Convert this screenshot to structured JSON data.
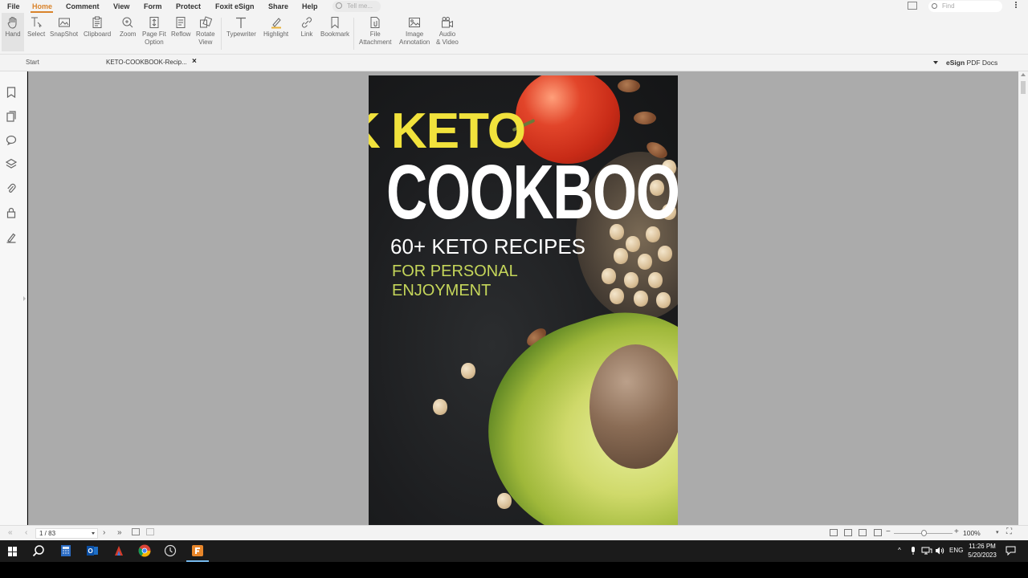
{
  "menu": {
    "items": [
      "File",
      "Home",
      "Comment",
      "View",
      "Form",
      "Protect",
      "Foxit eSign",
      "Share",
      "Help"
    ],
    "active": "Home",
    "tell_me_placeholder": "Tell me...",
    "find_placeholder": "Find"
  },
  "ribbon": {
    "tools": [
      {
        "label": "Hand",
        "icon": "hand-icon"
      },
      {
        "label": "Select",
        "icon": "select-icon"
      },
      {
        "label": "SnapShot",
        "icon": "snapshot-icon"
      },
      {
        "label": "Clipboard",
        "icon": "clipboard-icon"
      },
      {
        "label": "Zoom",
        "icon": "zoom-icon"
      },
      {
        "label": "Page Fit Option",
        "icon": "page-fit-icon"
      },
      {
        "label": "Reflow",
        "icon": "reflow-icon"
      },
      {
        "label": "Rotate View",
        "icon": "rotate-view-icon"
      },
      {
        "label": "Typewriter",
        "icon": "typewriter-icon"
      },
      {
        "label": "Highlight",
        "icon": "highlight-icon"
      },
      {
        "label": "Link",
        "icon": "link-icon"
      },
      {
        "label": "Bookmark",
        "icon": "bookmark-icon"
      },
      {
        "label": "File Attachment",
        "icon": "file-attachment-icon"
      },
      {
        "label": "Image Annotation",
        "icon": "image-annotation-icon"
      },
      {
        "label": "Audio & Video",
        "icon": "audio-video-icon"
      }
    ],
    "label_lines": {
      "page_fit_1": "Page Fit",
      "page_fit_2": "Option",
      "rotate_1": "Rotate",
      "rotate_2": "View",
      "file_att_1": "File",
      "file_att_2": "Attachment",
      "image_ann_1": "Image",
      "image_ann_2": "Annotation",
      "audio_1": "Audio",
      "audio_2": "& Video"
    }
  },
  "tabs": {
    "start": "Start",
    "document": "KETO-COOKBOOK-Recip...",
    "close": "×"
  },
  "esign": {
    "brand": "eSign",
    "label": "PDF Docs"
  },
  "cover": {
    "keto": "KETO",
    "cookbook": "COOKBOOK",
    "recipes": "60+ KETO RECIPES",
    "personal": "FOR PERSONAL ENJOYMENT"
  },
  "status": {
    "page_indicator": "1 / 83",
    "zoom": "100%"
  },
  "taskbar": {
    "time": "11:26 PM",
    "date": "5/20/2023",
    "lang": "ENG"
  },
  "colors": {
    "accent": "#d9832b",
    "keto_yellow": "#f1e23c",
    "subtitle_green": "#c5d65a"
  }
}
